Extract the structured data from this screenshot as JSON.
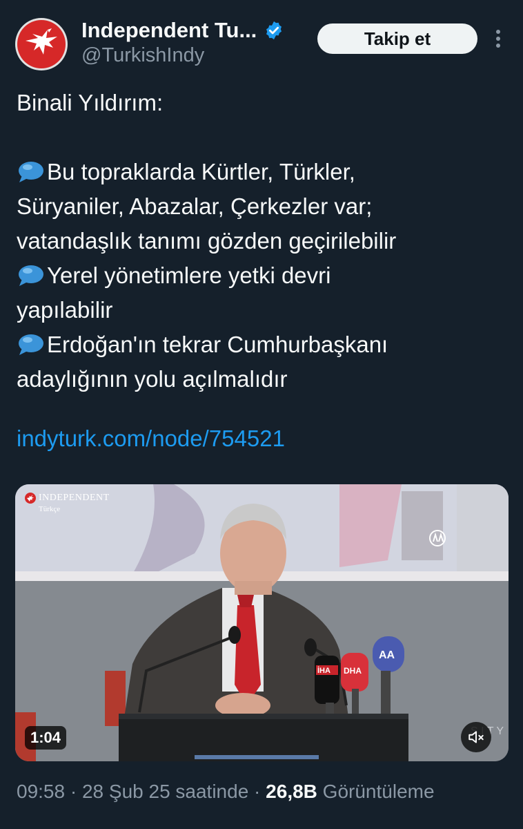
{
  "header": {
    "display_name": "Independent Tu...",
    "handle": "@TurkishIndy",
    "follow_label": "Takip et"
  },
  "tweet": {
    "lines": [
      "Binali Yıldırım:",
      "",
      "Bu topraklarda Kürtler, Türkler,",
      "Süryaniler, Abazalar, Çerkezler var;",
      "vatandaşlık tanımı gözden geçirilebilir",
      "Yerel yönetimlere yetki devri",
      "yapılabilir",
      "Erdoğan'ın tekrar Cumhurbaşkanı",
      "adaylığının yolu açılmalıdır"
    ],
    "link": "indyturk.com/node/754521"
  },
  "media": {
    "watermark_title": "INDEPENDENT",
    "watermark_sub": "Türkçe",
    "duration": "1:04",
    "mic_labels": [
      "İHA",
      "DHA",
      "AA"
    ],
    "podium_text": "S I T Y",
    "accent": "#d62828"
  },
  "meta": {
    "time": "09:58",
    "sep1": " · ",
    "date": "28 Şub 25 saatinde",
    "sep2": " · ",
    "views_count": "26,8B",
    "views_label": " Görüntüleme"
  },
  "icons": {
    "verified": "verified-badge-icon",
    "more": "more-vertical-icon",
    "speech": "speech-bubble-icon",
    "mute": "mute-icon"
  },
  "colors": {
    "background": "#15202b",
    "link": "#1d9bf0",
    "secondary_text": "#8b98a5",
    "verified": "#1d9bf0"
  }
}
